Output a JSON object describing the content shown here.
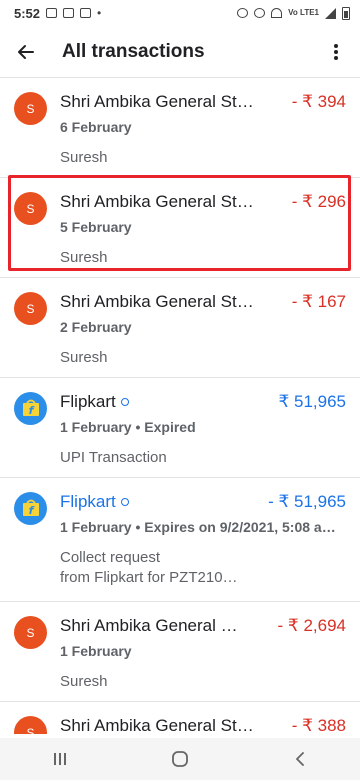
{
  "status_bar": {
    "time": "5:52",
    "network": "Vo LTE1"
  },
  "header": {
    "title": "All transactions"
  },
  "transactions": [
    {
      "avatar": "S",
      "merchant": "Shri Ambika General St…",
      "amount": "- ₹ 394",
      "date": "6 February",
      "note": "Suresh"
    },
    {
      "avatar": "S",
      "merchant": "Shri Ambika General St…",
      "amount": "- ₹ 296",
      "date": "5 February",
      "note": "Suresh"
    },
    {
      "avatar": "S",
      "merchant": "Shri Ambika General St…",
      "amount": "- ₹ 167",
      "date": "2 February",
      "note": "Suresh"
    },
    {
      "avatar": "f",
      "merchant": "Flipkart",
      "amount": "₹ 51,965",
      "date": "1 February • Expired",
      "note": "UPI Transaction"
    },
    {
      "avatar": "f",
      "merchant": "Flipkart",
      "amount": "- ₹ 51,965",
      "date": "1 February • Expires on 9/2/2021, 5:08 a…",
      "note_line1": "Collect request",
      "note_line2": "from Flipkart for PZT210…"
    },
    {
      "avatar": "S",
      "merchant": "Shri Ambika General …",
      "amount": "- ₹ 2,694",
      "date": "1 February",
      "note": "Suresh"
    },
    {
      "avatar": "S",
      "merchant": "Shri Ambika General St…",
      "amount": "- ₹ 388"
    }
  ],
  "colors": {
    "debit": "#d93025",
    "credit": "#1a73e8",
    "merchant_avatar": "#e8501f",
    "flipkart_avatar": "#2b8ee8",
    "highlight_box": "#e8242a"
  },
  "icons": [
    "back-arrow-icon",
    "more-vert-icon",
    "clock-icon",
    "flipkart-logo-icon",
    "recents-icon",
    "home-icon",
    "nav-back-icon"
  ]
}
